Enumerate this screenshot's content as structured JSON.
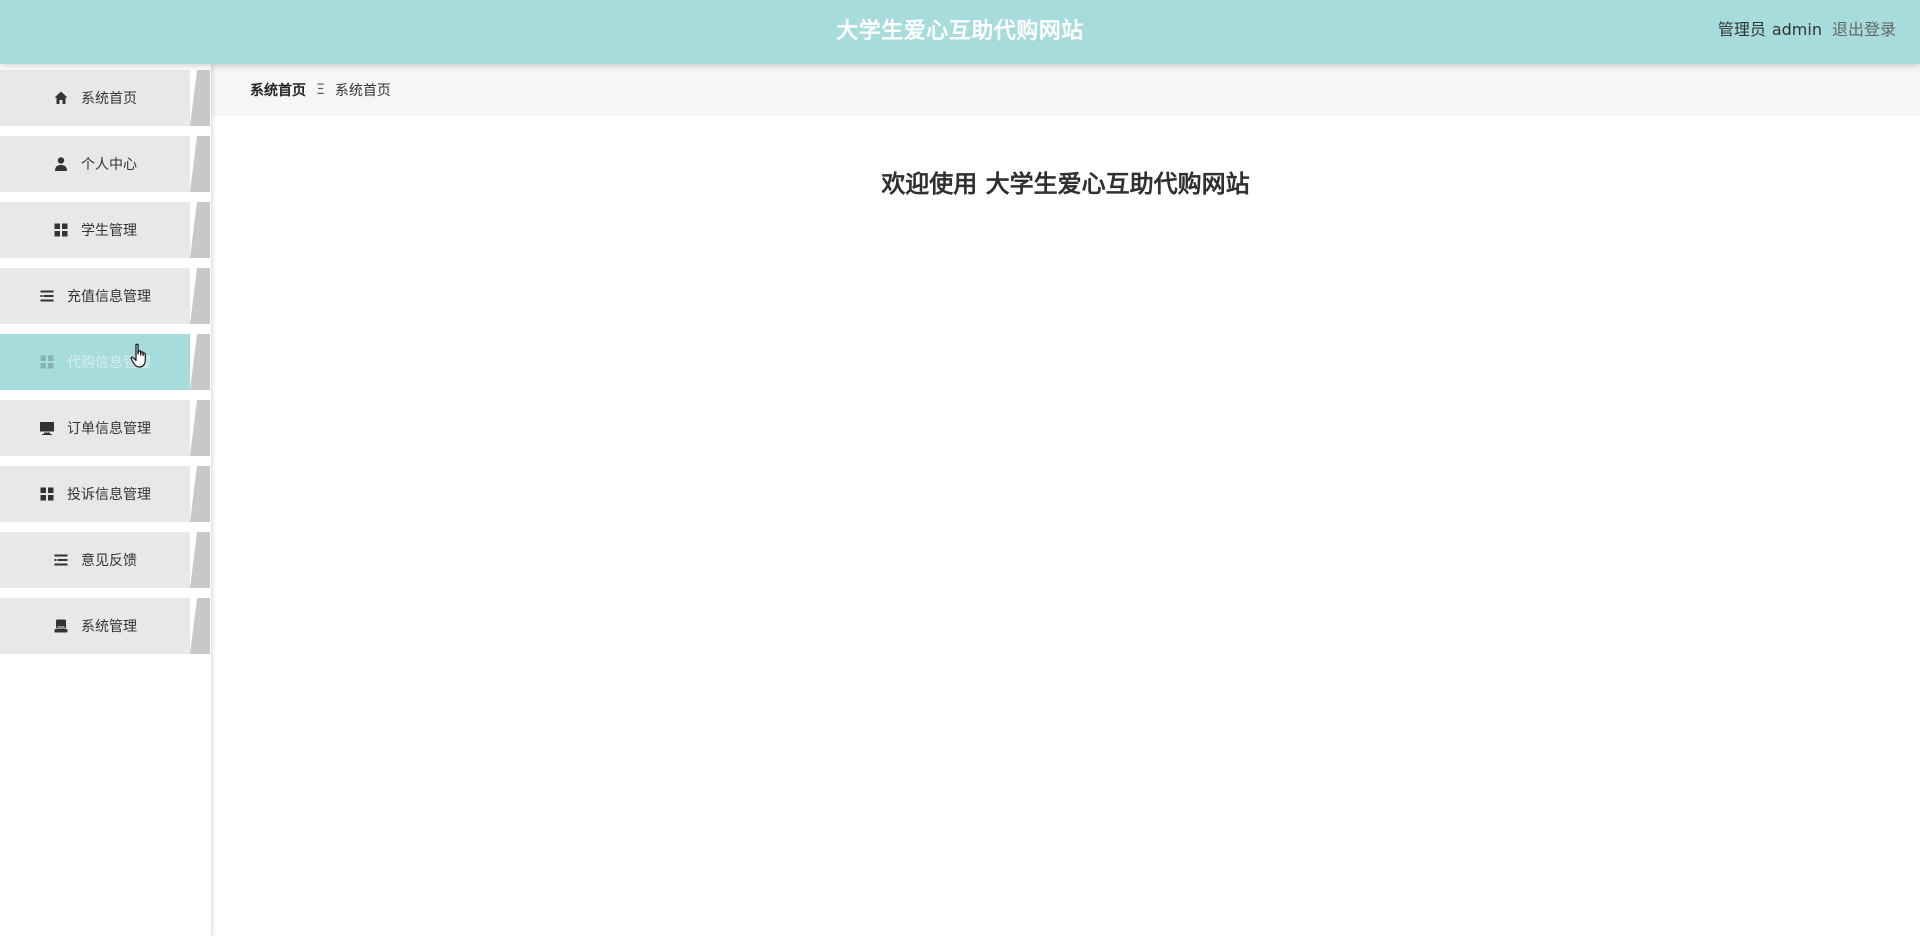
{
  "header": {
    "title": "大学生爱心互助代购网站",
    "role_label": "管理员",
    "username": "admin",
    "logout_label": "退出登录",
    "background_color": "#a6dcdc"
  },
  "sidebar": {
    "items": [
      {
        "label": "系统首页",
        "icon": "home-icon",
        "active": false
      },
      {
        "label": "个人中心",
        "icon": "person-icon",
        "active": false
      },
      {
        "label": "学生管理",
        "icon": "grid-icon",
        "active": false
      },
      {
        "label": "充值信息管理",
        "icon": "list-icon",
        "active": false
      },
      {
        "label": "代购信息管理",
        "icon": "grid-icon",
        "active": true
      },
      {
        "label": "订单信息管理",
        "icon": "monitor-icon",
        "active": false
      },
      {
        "label": "投诉信息管理",
        "icon": "grid-icon",
        "active": false
      },
      {
        "label": "意见反馈",
        "icon": "list-icon",
        "active": false
      },
      {
        "label": "系统管理",
        "icon": "printer-icon",
        "active": false
      }
    ],
    "active_color": "#a6dcdc"
  },
  "breadcrumb": {
    "home": "系统首页",
    "separator": "Ξ",
    "current": "系统首页"
  },
  "main": {
    "welcome_text": "欢迎使用 大学生爱心互助代购网站"
  }
}
